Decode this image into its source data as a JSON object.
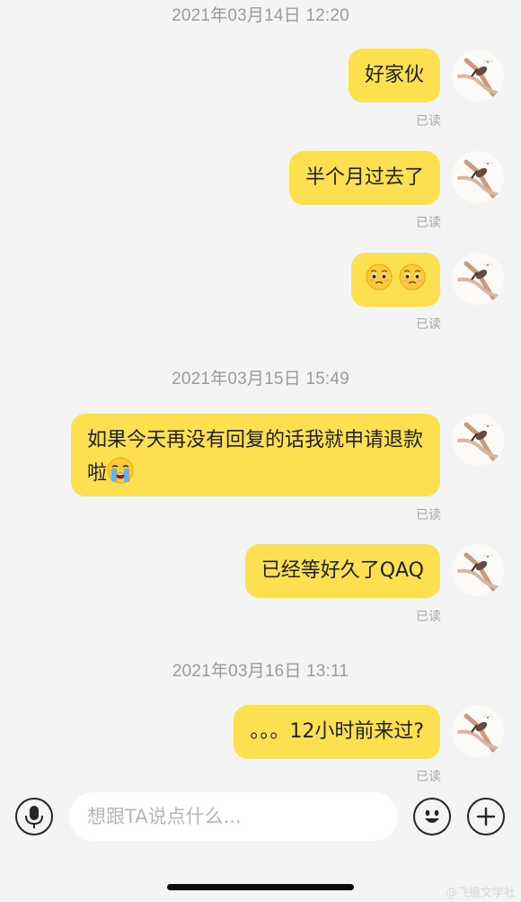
{
  "messages": [
    {
      "time": "2021年03月14日 12:20"
    },
    {
      "text": "好家伙",
      "status": "已读"
    },
    {
      "text": "半个月过去了",
      "status": "已读"
    },
    {
      "emoji": [
        "pleading-face",
        "pleading-face"
      ],
      "status": "已读"
    },
    {
      "time": "2021年03月15日 15:49"
    },
    {
      "text": "如果今天再没有回复的话我就申请退款啦",
      "emoji": "loudly-crying-face",
      "status": "已读"
    },
    {
      "text": "已经等好久了QAQ",
      "status": "已读"
    },
    {
      "time": "2021年03月16日 13:11"
    },
    {
      "text": "。。。12小时前来过?",
      "status": "已读"
    }
  ],
  "input": {
    "placeholder": "想跟TA说点什么..."
  },
  "icons": {
    "voice": "microphone-icon",
    "emoji": "smiley-icon",
    "more": "plus-icon"
  },
  "watermark": "@飞蛾文学社",
  "colors": {
    "bubble": "#fde050",
    "background": "#f4f4f4",
    "timestamp": "#9a9a9a"
  }
}
